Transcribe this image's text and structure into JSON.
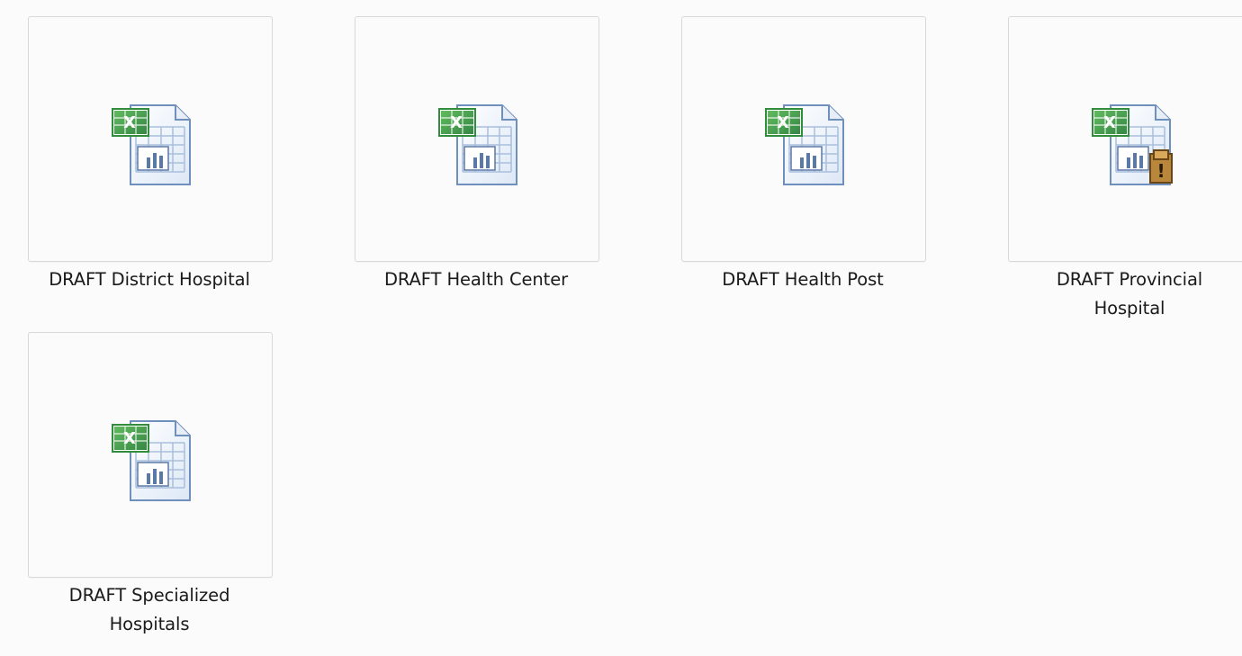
{
  "files": [
    {
      "name": "DRAFT District Hospital",
      "icon": "excel-chart-icon"
    },
    {
      "name": "DRAFT Health Center",
      "icon": "excel-chart-icon"
    },
    {
      "name": "DRAFT Health Post",
      "icon": "excel-chart-icon"
    },
    {
      "name": "DRAFT Provincial Hospital",
      "icon": "excel-warning-icon"
    },
    {
      "name": "DRAFT Specialized Hospitals",
      "icon": "excel-workbook-icon"
    }
  ],
  "colors": {
    "background": "#fbfbfb",
    "tile_border": "#d9d9d9",
    "text": "#1a1a1a",
    "excel_green": "#2f8d3b",
    "sheet_blue": "#7a9cc6"
  }
}
